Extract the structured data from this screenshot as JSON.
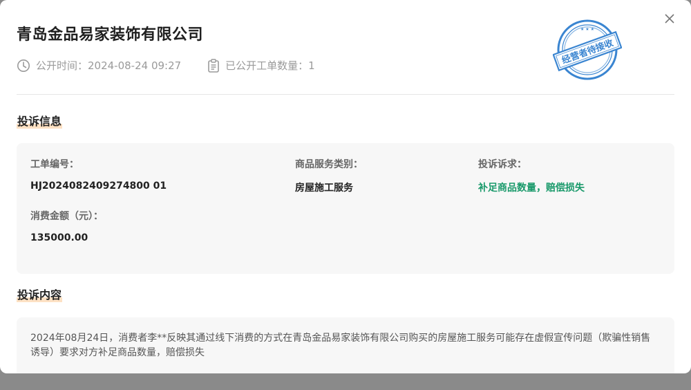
{
  "company_name": "青岛金品易家装饰有限公司",
  "meta": {
    "publish_time": "公开时间：2024-08-24 09:27",
    "order_count": "已公开工单数量：1"
  },
  "stamp_text": "经营者待接收",
  "sections": {
    "complaint_info_title": "投诉信息",
    "complaint_content_title": "投诉内容"
  },
  "fields": {
    "order_no_label": "工单编号：",
    "order_no_value": "HJ2024082409274800 01",
    "category_label": "商品服务类别：",
    "category_value": "房屋施工服务",
    "demand_label": "投诉诉求：",
    "demand_value": "补足商品数量，赔偿损失",
    "amount_label": "消费金额（元）：",
    "amount_value": "135000.00"
  },
  "content_text": "2024年08月24日，消费者李**反映其通过线下消费的方式在青岛金品易家装饰有限公司购买的房屋施工服务可能存在虚假宣传问题（欺骗性销售诱导）要求对方补足商品数量，赔偿损失",
  "colors": {
    "accent_green": "#1a9a6b",
    "stamp_blue": "#3a85d1",
    "underline_orange": "#fde1c4"
  },
  "icons": {
    "close": "close-icon",
    "clock": "clock-icon",
    "clipboard": "clipboard-icon"
  }
}
